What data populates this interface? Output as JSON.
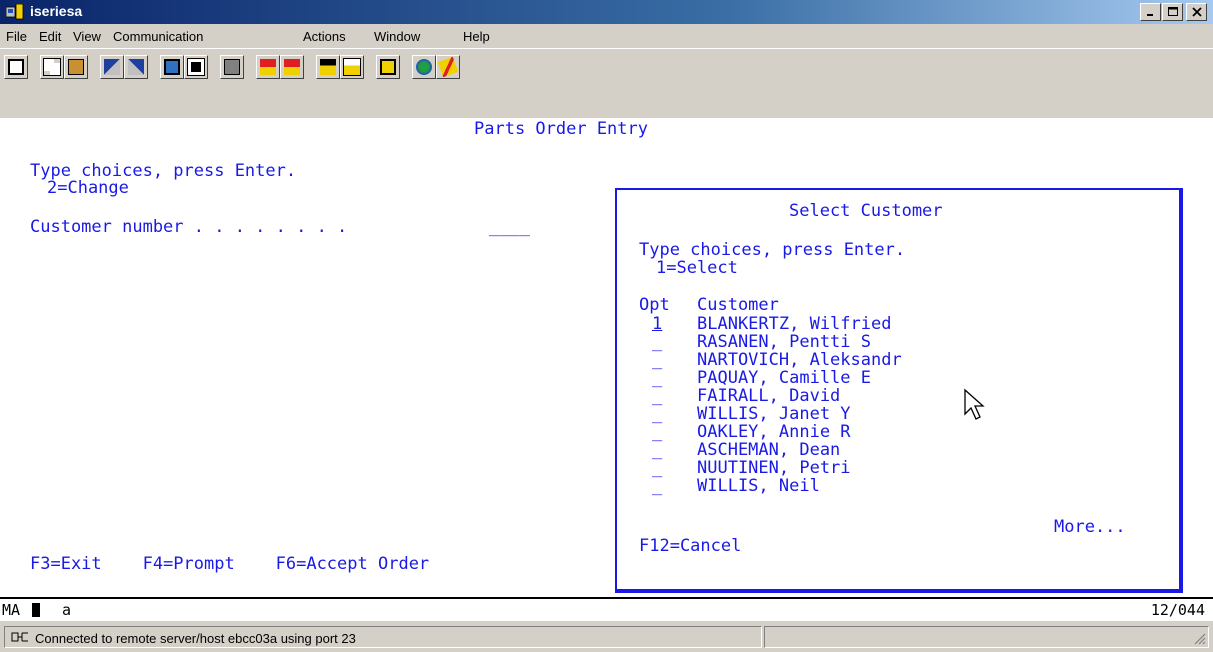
{
  "window": {
    "title": "iseriesa"
  },
  "menu": [
    "File",
    "Edit",
    "View",
    "Communication",
    "Actions",
    "Window",
    "Help"
  ],
  "toolbar": {
    "buttons": [
      "print-screen-icon",
      "copy-icon",
      "paste-icon",
      "send-file-icon",
      "receive-file-icon",
      "display-keypad-icon",
      "macro-icon",
      "record-macro-icon",
      "play-macro-icon",
      "stop-macro-icon",
      "start-session-icon",
      "stop-session-icon",
      "clipboard-icon",
      "web-icon",
      "help-icon"
    ]
  },
  "screen": {
    "title": "Parts Order Entry",
    "instructions": "Type choices, press Enter.",
    "option_hint": "2=Change",
    "customer_label": "Customer number . . . . . . . .",
    "customer_value": "____",
    "fkeys": "F3=Exit    F4=Prompt    F6=Accept Order"
  },
  "popup": {
    "title": "Select Customer",
    "instructions": "Type choices, press Enter.",
    "option_hint": "1=Select",
    "col_opt": "Opt",
    "col_customer": "Customer",
    "rows": [
      {
        "opt": "1",
        "name": "BLANKERTZ, Wilfried"
      },
      {
        "opt": "_",
        "name": "RASANEN, Pentti S"
      },
      {
        "opt": "_",
        "name": "NARTOVICH, Aleksandr"
      },
      {
        "opt": "_",
        "name": "PAQUAY, Camille E"
      },
      {
        "opt": "_",
        "name": "FAIRALL, David"
      },
      {
        "opt": "_",
        "name": "WILLIS, Janet Y"
      },
      {
        "opt": "_",
        "name": "OAKLEY, Annie R"
      },
      {
        "opt": "_",
        "name": "ASCHEMAN, Dean"
      },
      {
        "opt": "_",
        "name": "NUUTINEN, Petri"
      },
      {
        "opt": "_",
        "name": "WILLIS, Neil"
      }
    ],
    "more": "More...",
    "fkeys": "F12=Cancel"
  },
  "statusline": {
    "mode": "MA",
    "session": "a",
    "position": "12/044"
  },
  "statusbar": {
    "connection": "Connected to remote server/host ebcc03a using port 23"
  }
}
